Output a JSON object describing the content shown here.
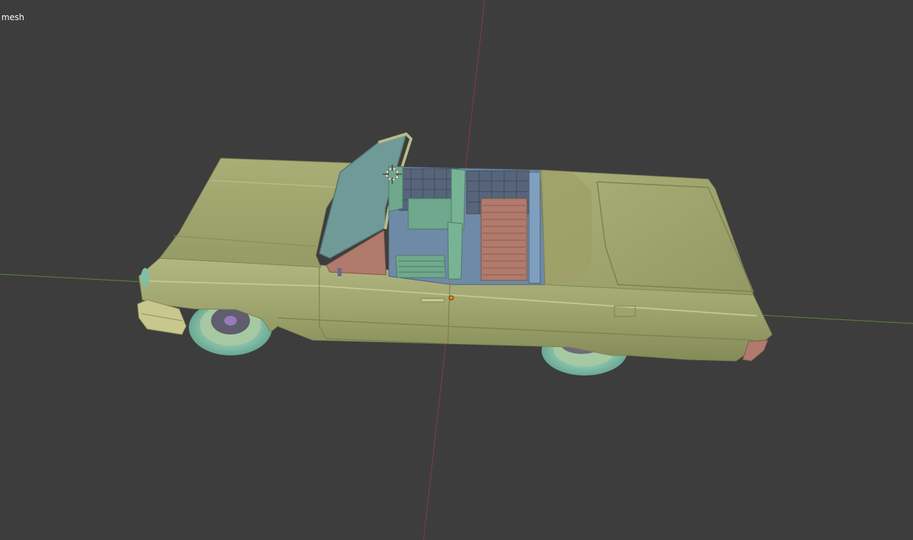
{
  "viewport": {
    "object_label": "mesh",
    "colors": {
      "background": "#3d3d3d",
      "x_axis": "#8a3b45",
      "y_axis": "#5d8a36",
      "car_body": "#9da46c",
      "body_light": "#b7bd86",
      "body_dark": "#7d8452",
      "glass": "#6f9a98",
      "interior_seat": "#6fa88c",
      "interior_floor": "#6f8aa6",
      "interior_tile": "#56657a",
      "trim_pink": "#b07a6c",
      "wheel_tire": "#7fbfa6",
      "spoke_hub": "#9a7ab8",
      "origin_point": "#ff8a00"
    }
  }
}
